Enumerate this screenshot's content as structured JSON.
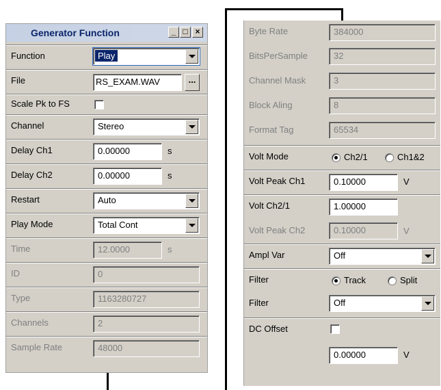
{
  "window": {
    "title": "Generator Function",
    "minimize_glyph": "_",
    "maximize_glyph": "□",
    "close_glyph": "×"
  },
  "left": {
    "function": {
      "label": "Function",
      "value": "Play"
    },
    "file": {
      "label": "File",
      "value": "RS_EXAM.WAV",
      "browse": "..."
    },
    "scale": {
      "label": "Scale Pk to FS",
      "checked": false
    },
    "channel": {
      "label": "Channel",
      "value": "Stereo"
    },
    "delay_ch1": {
      "label": "Delay Ch1",
      "value": "0.00000",
      "unit": "s"
    },
    "delay_ch2": {
      "label": "Delay Ch2",
      "value": "0.00000",
      "unit": "s"
    },
    "restart": {
      "label": "Restart",
      "value": "Auto"
    },
    "play_mode": {
      "label": "Play Mode",
      "value": "Total Cont"
    },
    "time": {
      "label": "Time",
      "value": "12.0000",
      "unit": "s"
    },
    "id": {
      "label": "ID",
      "value": "0"
    },
    "type": {
      "label": "Type",
      "value": "1163280727"
    },
    "channels": {
      "label": "Channels",
      "value": "2"
    },
    "sample_rate": {
      "label": "Sample Rate",
      "value": "48000"
    }
  },
  "right": {
    "byte_rate": {
      "label": "Byte Rate",
      "value": "384000"
    },
    "bits_per_sample": {
      "label": "BitsPerSample",
      "value": "32"
    },
    "channel_mask": {
      "label": "Channel Mask",
      "value": "3"
    },
    "block_aling": {
      "label": "Block Aling",
      "value": "8"
    },
    "format_tag": {
      "label": "Format Tag",
      "value": "65534"
    },
    "volt_mode": {
      "label": "Volt Mode",
      "option1": "Ch2/1",
      "option2": "Ch1&2",
      "selected": "Ch2/1"
    },
    "volt_peak_ch1": {
      "label": "Volt Peak Ch1",
      "value": "0.10000",
      "unit": "V"
    },
    "volt_ch21": {
      "label": "Volt Ch2/1",
      "value": "1.00000"
    },
    "volt_peak_ch2": {
      "label": "Volt Peak Ch2",
      "value": "0.10000",
      "unit": "V"
    },
    "ampl_var": {
      "label": "Ampl Var",
      "value": "Off"
    },
    "filter_mode": {
      "label": "Filter",
      "option1": "Track",
      "option2": "Split",
      "selected": "Track"
    },
    "filter": {
      "label": "Filter",
      "value": "Off"
    },
    "dc_offset": {
      "label": "DC Offset",
      "checked": false,
      "value": "0.00000",
      "unit": "V"
    }
  }
}
